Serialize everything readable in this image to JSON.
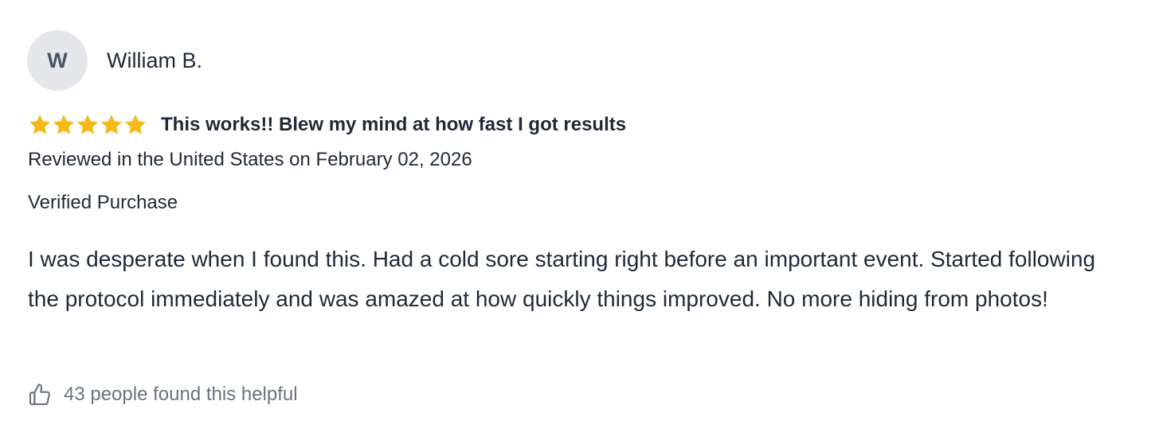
{
  "reviewer": {
    "initial": "W",
    "name": "William B."
  },
  "review": {
    "rating": 5,
    "rating_max": 5,
    "star_color": "#f5b91c",
    "star_icon": "star-icon",
    "title": "This works!! Blew my mind at how fast I got results",
    "meta": "Reviewed in the United States on February 02, 2026",
    "verified": "Verified Purchase",
    "body": "I was desperate when I found this. Had a cold sore starting right before an important event. Started following the protocol immediately and was amazed at how quickly things improved. No more hiding from photos!"
  },
  "helpful": {
    "icon": "thumbs-up-icon",
    "text": "43 people found this helpful"
  }
}
